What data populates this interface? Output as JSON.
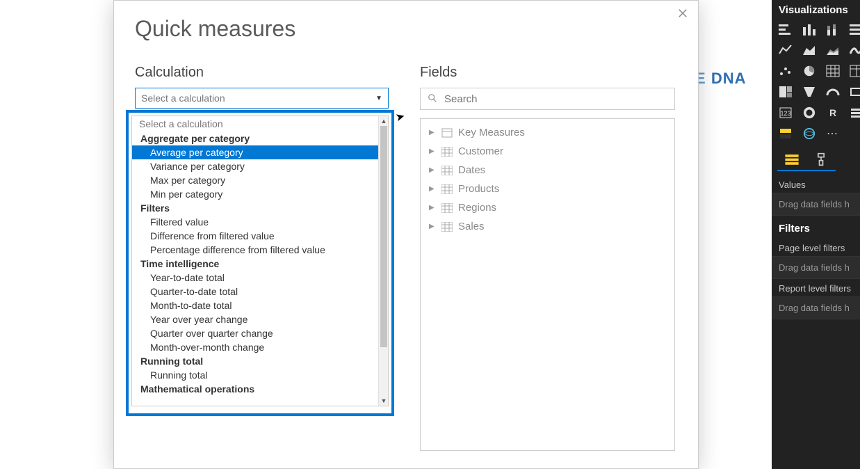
{
  "brand": {
    "part1": "E",
    "part2": "DNA"
  },
  "dialog": {
    "title": "Quick measures",
    "calc": {
      "heading": "Calculation",
      "selectPlaceholder": "Select a calculation",
      "placeholderItem": "Select a calculation",
      "selected": "Average per category",
      "groups": [
        {
          "label": "Aggregate per category",
          "items": [
            "Average per category",
            "Variance per category",
            "Max per category",
            "Min per category"
          ]
        },
        {
          "label": "Filters",
          "items": [
            "Filtered value",
            "Difference from filtered value",
            "Percentage difference from filtered value"
          ]
        },
        {
          "label": "Time intelligence",
          "items": [
            "Year-to-date total",
            "Quarter-to-date total",
            "Month-to-date total",
            "Year over year change",
            "Quarter over quarter change",
            "Month-over-month change"
          ]
        },
        {
          "label": "Running total",
          "items": [
            "Running total"
          ]
        },
        {
          "label": "Mathematical operations",
          "items": []
        }
      ]
    },
    "fields": {
      "heading": "Fields",
      "searchPlaceholder": "Search",
      "tables": [
        {
          "name": "Key Measures",
          "icon": "measure"
        },
        {
          "name": "Customer",
          "icon": "table"
        },
        {
          "name": "Dates",
          "icon": "table"
        },
        {
          "name": "Products",
          "icon": "table"
        },
        {
          "name": "Regions",
          "icon": "table"
        },
        {
          "name": "Sales",
          "icon": "table"
        }
      ]
    }
  },
  "visPanel": {
    "title": "Visualizations",
    "valuesLabel": "Values",
    "dragHint": "Drag data fields h",
    "filtersHeading": "Filters",
    "pageFilters": "Page level filters",
    "reportFilters": "Report level filters",
    "icons": [
      "stacked-bar",
      "clustered-column",
      "stacked-column",
      "stacked-bar-100",
      "line",
      "area",
      "stacked-area",
      "ribbon",
      "scatter",
      "pie",
      "matrix",
      "table",
      "treemap",
      "funnel",
      "gauge",
      "card",
      "kpi",
      "donut",
      "r-visual",
      "slicer",
      "multi-row",
      "arcgis",
      "ellipsis",
      ""
    ]
  }
}
